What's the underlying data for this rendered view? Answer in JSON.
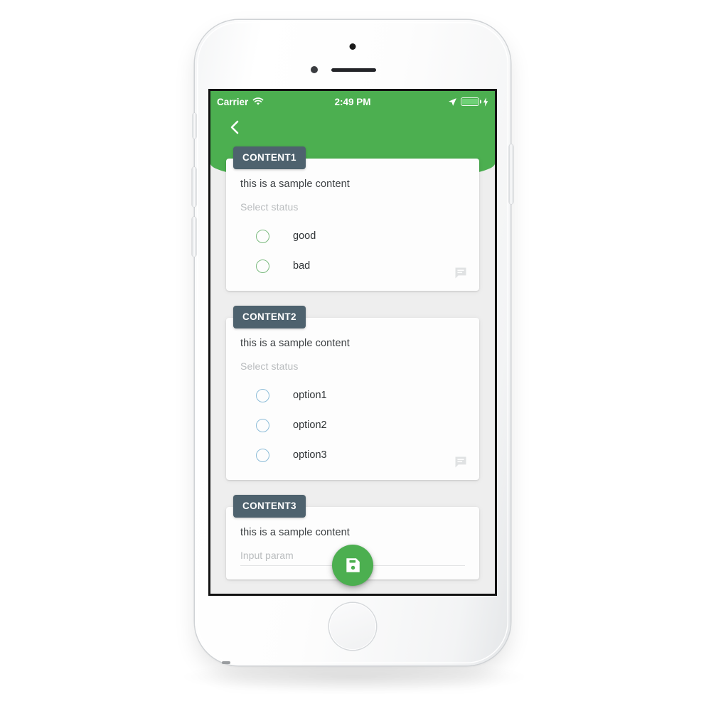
{
  "device": {
    "name": "iphone-white",
    "frame_color": "#f4f5f6"
  },
  "status_bar": {
    "carrier": "Carrier",
    "wifi_icon": "wifi-icon",
    "time": "2:49 PM",
    "location_icon": "location-arrow-icon",
    "battery_icon": "battery-icon",
    "charging_icon": "lightning-bolt-icon",
    "background_color": "#4caf50"
  },
  "header": {
    "back_icon": "chevron-left-icon",
    "background_color": "#4caf50"
  },
  "app": {
    "background_color": "#eeeeee",
    "badge_color": "#4e626e",
    "accent_color": "#4caf50"
  },
  "cards": [
    {
      "badge": "CONTENT1",
      "content": "this is a sample content",
      "label": "Select status",
      "radio_color": "#7aba7e",
      "radio_style": "green",
      "options": [
        "good",
        "bad"
      ],
      "comment_icon": "comment-icon"
    },
    {
      "badge": "CONTENT2",
      "content": "this is a sample content",
      "label": "Select status",
      "radio_color": "#8cbcd8",
      "radio_style": "blue",
      "options": [
        "option1",
        "option2",
        "option3"
      ],
      "comment_icon": "comment-icon"
    },
    {
      "badge": "CONTENT3",
      "content": "this is a sample content",
      "input_placeholder": "Input param"
    }
  ],
  "fab": {
    "icon": "save-floppy-icon",
    "color": "#4caf50",
    "label": "Save"
  }
}
